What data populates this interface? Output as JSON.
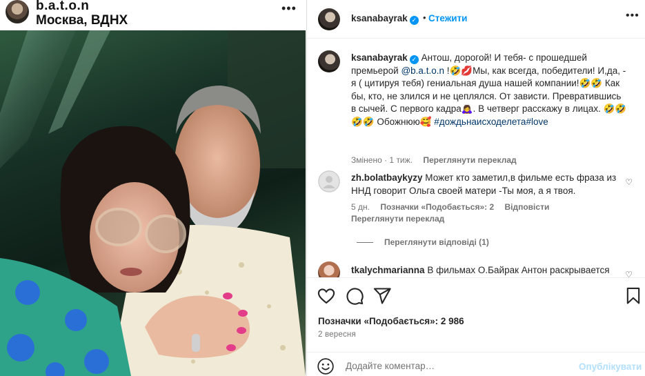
{
  "media": {
    "username": "b.a.t.o.n",
    "location": "Москва, ВДНХ",
    "more_icon": "more-horizontal-icon"
  },
  "post": {
    "author": "ksanabayrak",
    "follow_label": "Стежити",
    "caption": {
      "part1": "Антош, дорогой! И тебя- с прошедшей премьерой ",
      "mention": "@b.a.t.o.n",
      "part2": " !🤣💋Мы, как всегда, победители! И,да, - я ( цитируя тебя) гениальная душа нашей компании!🤣🤣 Как бы, кто, не злился и не цеплялся. От зависти. Превратившись в сычей. С первого кадра🙇‍♀️. В четверг расскажу в лицах. 🤣🤣🤣🤣 Обожнюю🥰",
      "hashtags": "#дождьнаисходелета#love"
    },
    "caption_meta": {
      "edited": "Змінено · 1 тиж.",
      "see_translation": "Переглянути переклад"
    },
    "comments": [
      {
        "user": "zh.bolatbaykyzy",
        "text": "Может кто заметил,в фильме есть фраза из ННД говорит Ольга своей матери -Ты моя, а я твоя.",
        "time": "5 дн.",
        "likes": "Позначки «Подобається»: 2",
        "reply": "Відповісти",
        "see_translation": "Переглянути переклад",
        "view_replies": "Переглянути відповіді (1)"
      },
      {
        "user": "tkalychmarianna",
        "text": "В фильмах О.Байрак Антон раскрывается"
      }
    ],
    "likes_count": "Позначки «Подобається»: 2 986",
    "date": "2 вересня",
    "add_comment_placeholder": "Додайте коментар…",
    "publish_label": "Опублікувати"
  },
  "colors": {
    "accent": "#0095f6",
    "link": "#00376b",
    "muted": "#737373",
    "publish_disabled": "#b2dffc"
  }
}
